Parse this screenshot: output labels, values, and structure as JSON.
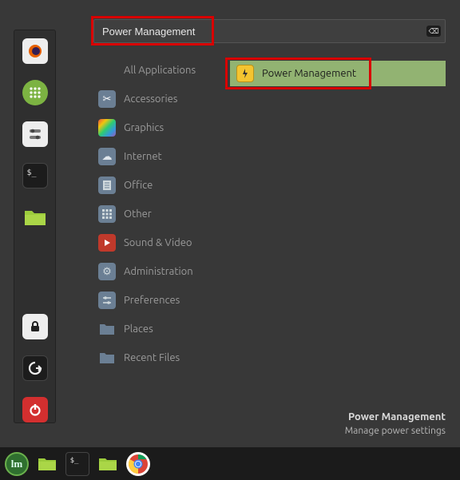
{
  "search": {
    "value": "Power Management",
    "clear_glyph": "⌫"
  },
  "favorites": [
    {
      "name": "firefox",
      "bg": "#eeeeee",
      "glyph_color": "#e66000"
    },
    {
      "name": "chat",
      "bg": "#7cb342",
      "glyph_color": "#ffffff"
    },
    {
      "name": "settings",
      "bg": "#eeeeee",
      "glyph_color": "#555555"
    },
    {
      "name": "terminal",
      "bg": "#1c1c1c",
      "glyph_color": "#dddddd"
    },
    {
      "name": "files",
      "bg": "#9ccc3c",
      "glyph_color": "#7aa326"
    },
    {
      "name": "lock",
      "bg": "#eeeeee",
      "glyph_color": "#222222"
    },
    {
      "name": "logout",
      "bg": "#1c1c1c",
      "glyph_color": "#eeeeee"
    },
    {
      "name": "shutdown",
      "bg": "#d32f2f",
      "glyph_color": "#ffffff"
    }
  ],
  "categories": [
    {
      "label": "All Applications",
      "icon": "none"
    },
    {
      "label": "Accessories",
      "icon": "scissors"
    },
    {
      "label": "Graphics",
      "icon": "rainbow"
    },
    {
      "label": "Internet",
      "icon": "cloud"
    },
    {
      "label": "Office",
      "icon": "sheet"
    },
    {
      "label": "Other",
      "icon": "grid"
    },
    {
      "label": "Sound & Video",
      "icon": "play"
    },
    {
      "label": "Administration",
      "icon": "gear"
    },
    {
      "label": "Preferences",
      "icon": "sliders"
    },
    {
      "label": "Places",
      "icon": "folder"
    },
    {
      "label": "Recent Files",
      "icon": "folder"
    }
  ],
  "results": [
    {
      "label": "Power Management",
      "icon": "power"
    }
  ],
  "tooltip": {
    "title": "Power Management",
    "desc": "Manage power settings"
  },
  "taskbar": {
    "menu_glyph": "lm",
    "items": [
      {
        "name": "files-pinned"
      },
      {
        "name": "terminal-pinned"
      },
      {
        "name": "files-open"
      },
      {
        "name": "chrome-pinned"
      }
    ]
  }
}
